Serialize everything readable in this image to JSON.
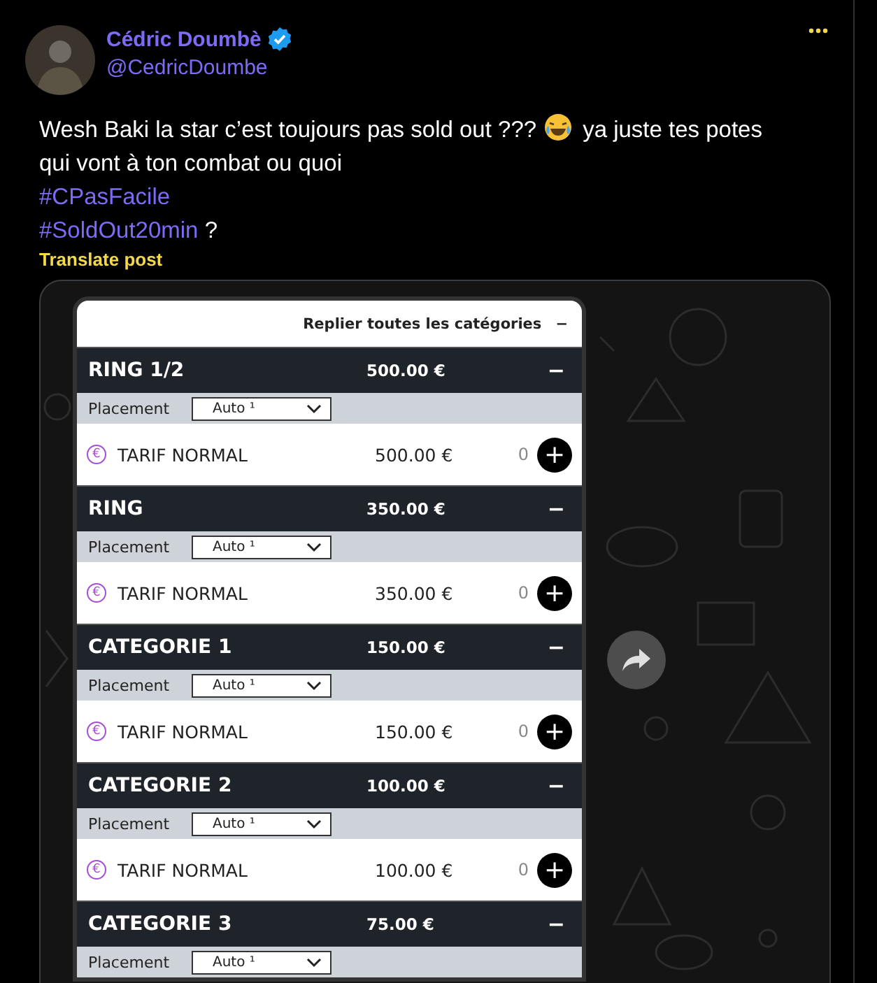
{
  "author": {
    "name": "Cédric Doumbè",
    "handle": "@CedricDoumbe",
    "verified": true
  },
  "post": {
    "text_parts": [
      "Wesh Baki la star c’est toujours pas sold out ???",
      "ya juste tes potes",
      "qui vont à ton combat ou quoi"
    ],
    "hashtags": [
      {
        "tag": "#CPasFacile"
      },
      {
        "tag": "#SoldOut20min",
        "after": "?"
      }
    ],
    "translate": "Translate post"
  },
  "media": {
    "collapse_all": {
      "label": "Replier toutes les catégories",
      "icon": "−"
    },
    "categories": [
      {
        "name": "RING 1/2",
        "price": "500.00 €",
        "toggle": "−",
        "placement": {
          "label": "Placement",
          "value": "Auto ¹"
        },
        "tariffs": [
          {
            "currency": "€",
            "name": "TARIF NORMAL",
            "price": "500.00 €",
            "quantity": "0",
            "add": "+"
          }
        ]
      },
      {
        "name": "RING",
        "price": "350.00 €",
        "toggle": "−",
        "placement": {
          "label": "Placement",
          "value": "Auto ¹"
        },
        "tariffs": [
          {
            "currency": "€",
            "name": "TARIF NORMAL",
            "price": "350.00 €",
            "quantity": "0",
            "add": "+"
          }
        ]
      },
      {
        "name": "CATEGORIE 1",
        "price": "150.00 €",
        "toggle": "−",
        "placement": {
          "label": "Placement",
          "value": "Auto ¹"
        },
        "tariffs": [
          {
            "currency": "€",
            "name": "TARIF NORMAL",
            "price": "150.00 €",
            "quantity": "0",
            "add": "+"
          }
        ]
      },
      {
        "name": "CATEGORIE 2",
        "price": "100.00 €",
        "toggle": "−",
        "placement": {
          "label": "Placement",
          "value": "Auto ¹"
        },
        "tariffs": [
          {
            "currency": "€",
            "name": "TARIF NORMAL",
            "price": "100.00 €",
            "quantity": "0",
            "add": "+"
          }
        ]
      },
      {
        "name": "CATEGORIE 3",
        "price": "75.00 €",
        "toggle": "−",
        "placement": {
          "label": "Placement",
          "value": "Auto ¹"
        }
      }
    ]
  }
}
